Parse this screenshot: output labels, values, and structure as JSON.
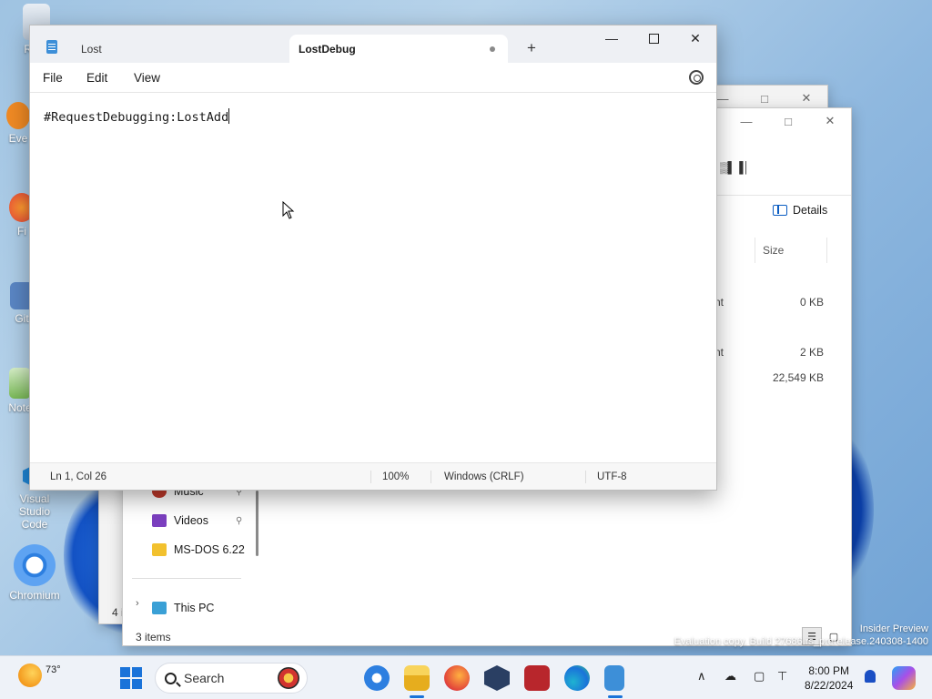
{
  "desktop": {
    "icons": [
      {
        "label": "Recy",
        "icon": "recycle-bin-icon"
      },
      {
        "label": "Eve",
        "icon": "app-icon"
      },
      {
        "label": "Fi",
        "icon": "firefox-icon"
      },
      {
        "label": "Git",
        "icon": "git-icon"
      },
      {
        "label": "Note",
        "icon": "notepad-plus-icon"
      },
      {
        "label": "Visual Studio Code",
        "icon": "vscode-icon"
      },
      {
        "label": "Chromium",
        "icon": "chromium-icon"
      }
    ]
  },
  "explorer": {
    "toolbar_text": "▒▌▐│",
    "details_label": "Details",
    "size_header": "Size",
    "rows": [
      {
        "type": "nt",
        "size": "0 KB"
      },
      {
        "type": "nt",
        "size": "2 KB"
      },
      {
        "type": "",
        "size": "22,549 KB"
      }
    ],
    "nav": [
      {
        "label": "Music",
        "color": "#c0392b"
      },
      {
        "label": "Videos",
        "color": "#7b3fbf"
      },
      {
        "label": "MS-DOS 6.22",
        "color": "#f2c12e"
      }
    ],
    "this_pc": "This PC",
    "status": "3 items",
    "back_status": "4 i"
  },
  "watermark": {
    "line1": "Insider Preview",
    "line2": "Evaluation copy. Build 27686.rs_prerelease.240308-1400"
  },
  "notepad": {
    "tabs": [
      {
        "label": "Lost"
      },
      {
        "label": "LostDebug",
        "modified": true
      }
    ],
    "add_tab": "+",
    "controls": {
      "minimize": "—",
      "close": "✕"
    },
    "menu": {
      "file": "File",
      "edit": "Edit",
      "view": "View"
    },
    "content": "#RequestDebugging:LostAdd",
    "status": {
      "position": "Ln 1, Col 26",
      "zoom": "100%",
      "line_ending": "Windows (CRLF)",
      "encoding": "UTF-8"
    }
  },
  "taskbar": {
    "weather_temp": "73°",
    "search_placeholder": "Search",
    "time": "8:00 PM",
    "date": "8/22/2024",
    "chevron": "∧"
  }
}
